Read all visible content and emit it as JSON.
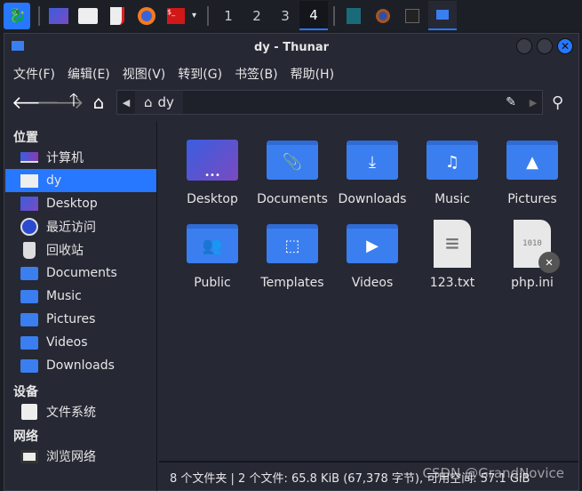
{
  "taskbar": {
    "workspaces": [
      "1",
      "2",
      "3",
      "4"
    ],
    "active_workspace": "4",
    "accent": "#2777ff"
  },
  "window": {
    "title": "dy - Thunar"
  },
  "menu": [
    "文件(F)",
    "编辑(E)",
    "视图(V)",
    "转到(G)",
    "书签(B)",
    "帮助(H)"
  ],
  "path": {
    "current": "dy"
  },
  "sidebar": {
    "places_header": "位置",
    "places": [
      {
        "label": "计算机",
        "icon": "computer-icon"
      },
      {
        "label": "dy",
        "icon": "home-folder-icon",
        "selected": true
      },
      {
        "label": "Desktop",
        "icon": "desktop-icon"
      },
      {
        "label": "最近访问",
        "icon": "recent-icon"
      },
      {
        "label": "回收站",
        "icon": "trash-icon"
      },
      {
        "label": "Documents",
        "icon": "folder-documents-icon"
      },
      {
        "label": "Music",
        "icon": "folder-music-icon"
      },
      {
        "label": "Pictures",
        "icon": "folder-pictures-icon"
      },
      {
        "label": "Videos",
        "icon": "folder-videos-icon"
      },
      {
        "label": "Downloads",
        "icon": "folder-downloads-icon"
      }
    ],
    "devices_header": "设备",
    "devices": [
      {
        "label": "文件系统",
        "icon": "drive-icon"
      }
    ],
    "network_header": "网络",
    "network": [
      {
        "label": "浏览网络",
        "icon": "network-icon"
      }
    ]
  },
  "files": [
    {
      "name": "Desktop",
      "glyph": "•••",
      "type": "desktop"
    },
    {
      "name": "Documents",
      "glyph": "📎",
      "type": "folder"
    },
    {
      "name": "Downloads",
      "glyph": "⤓",
      "type": "folder"
    },
    {
      "name": "Music",
      "glyph": "♫",
      "type": "folder"
    },
    {
      "name": "Pictures",
      "glyph": "▲",
      "type": "folder"
    },
    {
      "name": "Public",
      "glyph": "👥",
      "type": "folder"
    },
    {
      "name": "Templates",
      "glyph": "⬚",
      "type": "folder"
    },
    {
      "name": "Videos",
      "glyph": "▶",
      "type": "folder"
    },
    {
      "name": "123.txt",
      "glyph": "≡",
      "type": "text"
    },
    {
      "name": "php.ini",
      "glyph": "1010",
      "type": "binary"
    }
  ],
  "status": "8 个文件夹 | 2 个文件: 65.8 KiB (67,378 字节), 可用空间: 57.1 GiB",
  "watermark": "CSDN @GrandNovice",
  "colors": {
    "folder": "#3a7ef0",
    "selected": "#2777ff",
    "bg": "#262834"
  }
}
